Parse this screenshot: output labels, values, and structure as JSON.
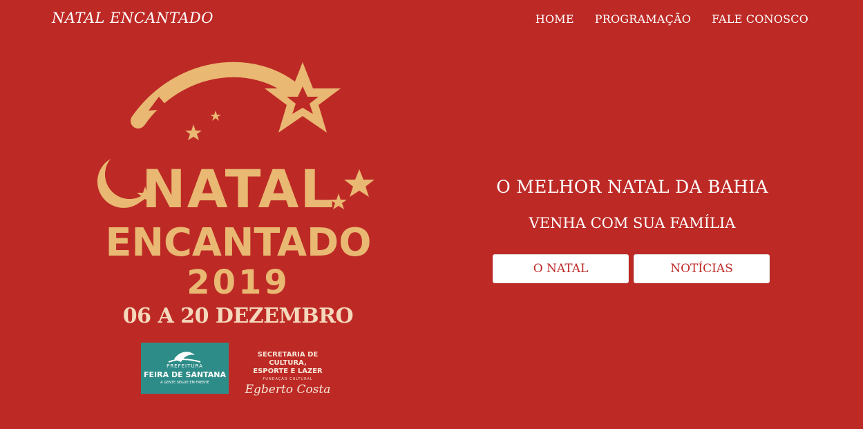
{
  "navbar": {
    "brand": "NATAL ENCANTADO",
    "links": [
      "HOME",
      "PROGRAMAÇÃO",
      "FALE CONOSCO"
    ]
  },
  "poster": {
    "logo_line1": "NATAL",
    "logo_line2": "ENCANTADO",
    "logo_year": "2019",
    "dates": "06 A 20 DEZEMBRO",
    "partner_left": {
      "top": "PREFEITURA",
      "name": "FEIRA DE SANTANA",
      "tagline": "A GENTE SEGUE EM FRENTE"
    },
    "partner_right": {
      "line1": "SECRETARIA DE CULTURA,",
      "line2": "ESPORTE E LAZER",
      "line3": "FUNDAÇÃO CULTURAL",
      "signature": "Egberto Costa"
    }
  },
  "hero": {
    "title": "O MELHOR NATAL DA BAHIA",
    "subtitle": "VENHA COM SUA FAMÍLIA",
    "buttons": [
      "O NATAL",
      "NOTÍCIAS"
    ]
  },
  "colors": {
    "background": "#bd2a26",
    "gold": "#e9b872",
    "teal": "#2e8c88"
  }
}
